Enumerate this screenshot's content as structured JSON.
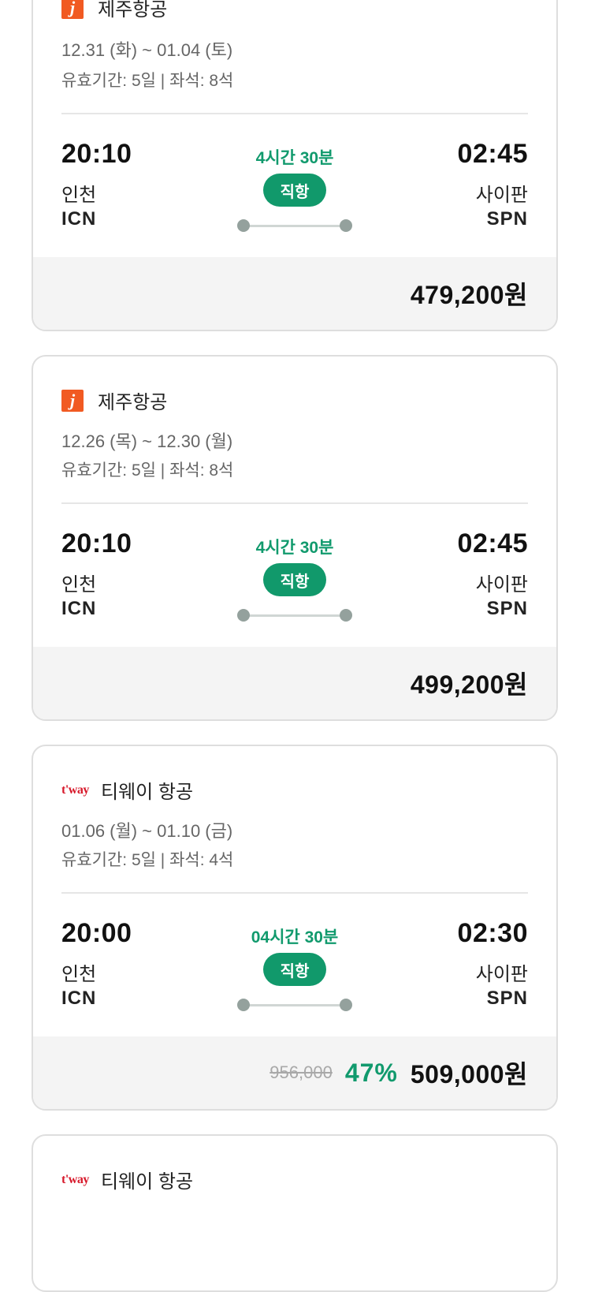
{
  "cards": [
    {
      "airline": "제주항공",
      "logo": "jeju-air-logo",
      "logo_text": "j",
      "dates": "12.31 (화) ~ 01.04 (토)",
      "validity": "유효기간: 5일 | 좌석: 8석",
      "departure": {
        "time": "20:10",
        "city": "인천",
        "code": "ICN"
      },
      "arrival": {
        "time": "02:45",
        "city": "사이판",
        "code": "SPN"
      },
      "duration": "4시간 30분",
      "flight_type": "직항",
      "original_price": "",
      "discount": "",
      "price": "479,200원"
    },
    {
      "airline": "제주항공",
      "logo": "jeju-air-logo",
      "logo_text": "j",
      "dates": "12.26 (목) ~ 12.30 (월)",
      "validity": "유효기간: 5일 | 좌석: 8석",
      "departure": {
        "time": "20:10",
        "city": "인천",
        "code": "ICN"
      },
      "arrival": {
        "time": "02:45",
        "city": "사이판",
        "code": "SPN"
      },
      "duration": "4시간 30분",
      "flight_type": "직항",
      "original_price": "",
      "discount": "",
      "price": "499,200원"
    },
    {
      "airline": "티웨이 항공",
      "logo": "tway-logo",
      "logo_text": "t'way",
      "dates": "01.06 (월) ~ 01.10 (금)",
      "validity": "유효기간: 5일 | 좌석: 4석",
      "departure": {
        "time": "20:00",
        "city": "인천",
        "code": "ICN"
      },
      "arrival": {
        "time": "02:30",
        "city": "사이판",
        "code": "SPN"
      },
      "duration": "04시간 30분",
      "flight_type": "직항",
      "original_price": "956,000",
      "discount": "47%",
      "price": "509,000원"
    },
    {
      "airline": "티웨이 항공",
      "logo": "tway-logo",
      "logo_text": "t'way"
    }
  ],
  "colors": {
    "accent_green": "#119a6d",
    "jeju_orange": "#f15a22",
    "tway_red": "#d7182a"
  }
}
